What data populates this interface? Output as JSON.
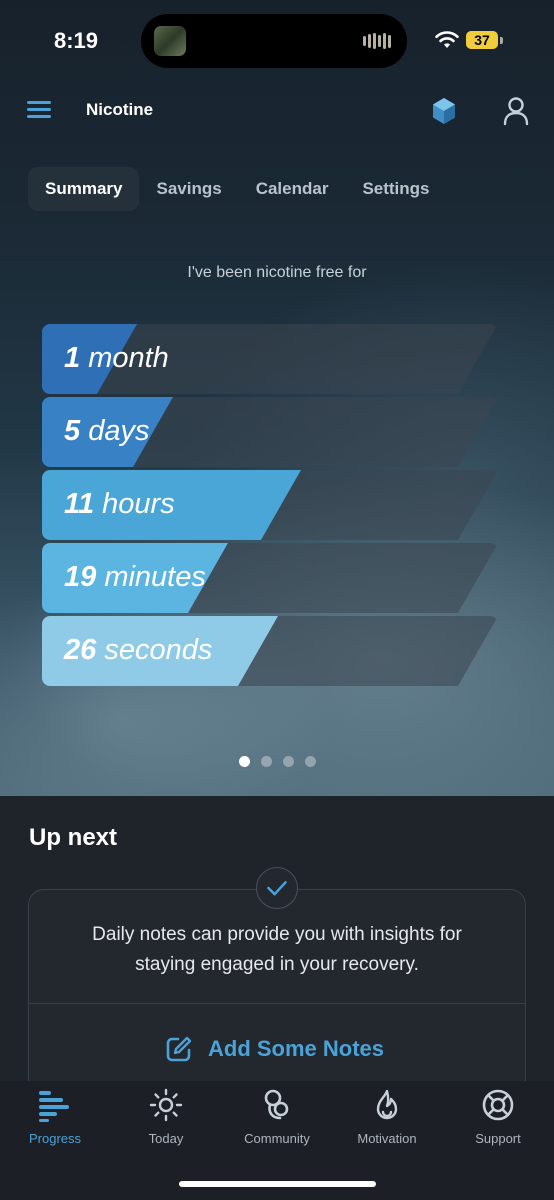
{
  "status_bar": {
    "time": "8:19",
    "battery": "37"
  },
  "header": {
    "title": "Nicotine",
    "menu_icon": "hamburger-icon",
    "badge_icon": "hexagon-badge-icon",
    "profile_icon": "person-icon"
  },
  "tabs": [
    {
      "label": "Summary",
      "active": true
    },
    {
      "label": "Savings",
      "active": false
    },
    {
      "label": "Calendar",
      "active": false
    },
    {
      "label": "Settings",
      "active": false
    }
  ],
  "intro_text": "I've been nicotine free for",
  "durations": [
    {
      "value": "1",
      "unit": "month",
      "fraction": 0.12,
      "color": "#2f6fb5"
    },
    {
      "value": "5",
      "unit": "days",
      "fraction": 0.2,
      "color": "#3881c4"
    },
    {
      "value": "11",
      "unit": "hours",
      "fraction": 0.48,
      "color": "#49a6d6"
    },
    {
      "value": "19",
      "unit": "minutes",
      "fraction": 0.32,
      "color": "#5bb5e0"
    },
    {
      "value": "26",
      "unit": "seconds",
      "fraction": 0.43,
      "color": "#8fcbe6"
    }
  ],
  "pager": {
    "count": 4,
    "active": 0
  },
  "up_next": {
    "heading": "Up next",
    "check_icon": "checkmark-icon",
    "message": "Daily notes can provide you with insights for staying engaged in your recovery.",
    "action_label": "Add Some Notes",
    "action_icon": "edit-note-icon"
  },
  "tab_bar": [
    {
      "label": "Progress",
      "icon": "progress-bars-icon",
      "active": true
    },
    {
      "label": "Today",
      "icon": "sun-icon",
      "active": false
    },
    {
      "label": "Community",
      "icon": "community-icon",
      "active": false
    },
    {
      "label": "Motivation",
      "icon": "flame-icon",
      "active": false
    },
    {
      "label": "Support",
      "icon": "lifebuoy-icon",
      "active": false
    }
  ],
  "colors": {
    "accent": "#4aa3d8",
    "background": "#1f232a"
  }
}
